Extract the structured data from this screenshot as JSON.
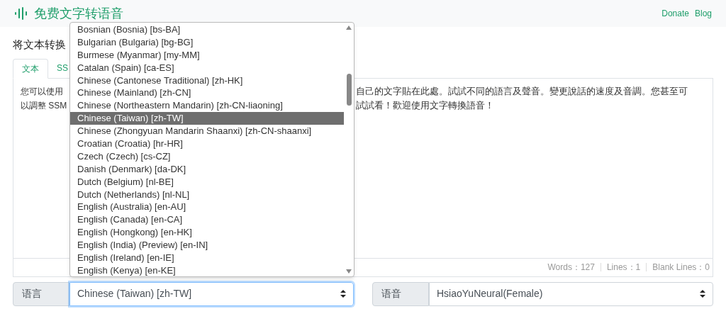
{
  "navbar": {
    "brand": "免费文字转语音",
    "links": [
      "Donate",
      "Blog"
    ]
  },
  "heading": "将文本转换",
  "tabs": [
    {
      "label": "文本",
      "selected": true
    },
    {
      "label": "SS",
      "selected": false
    }
  ],
  "editor": {
    "lines": [
      {
        "left": "您可以使用",
        "right": "自己的文字貼在此處。試試不同的語言及聲音。變更說話的速度及音調。您甚至可"
      },
      {
        "left": "以調整 SSM",
        "right": "試試看！歡迎使用文字轉換語音！"
      }
    ]
  },
  "stats": [
    "Words：127",
    "Lines：1",
    "Blank Lines：0"
  ],
  "language": {
    "label": "语言",
    "value": "Chinese (Taiwan) [zh-TW]",
    "focused": true
  },
  "voice": {
    "label": "语音",
    "value": "HsiaoYuNeural(Female)",
    "focused": false
  },
  "dropdown": {
    "options": [
      {
        "label": "Bosnian (Bosnia) [bs-BA]",
        "selected": false
      },
      {
        "label": "Bulgarian (Bulgaria) [bg-BG]",
        "selected": false
      },
      {
        "label": "Burmese (Myanmar) [my-MM]",
        "selected": false
      },
      {
        "label": "Catalan (Spain) [ca-ES]",
        "selected": false
      },
      {
        "label": "Chinese (Cantonese Traditional) [zh-HK]",
        "selected": false
      },
      {
        "label": "Chinese (Mainland) [zh-CN]",
        "selected": false
      },
      {
        "label": "Chinese (Northeastern Mandarin) [zh-CN-liaoning]",
        "selected": false
      },
      {
        "label": "Chinese (Taiwan) [zh-TW]",
        "selected": true
      },
      {
        "label": "Chinese (Zhongyuan Mandarin Shaanxi) [zh-CN-shaanxi]",
        "selected": false
      },
      {
        "label": "Croatian (Croatia) [hr-HR]",
        "selected": false
      },
      {
        "label": "Czech (Czech) [cs-CZ]",
        "selected": false
      },
      {
        "label": "Danish (Denmark) [da-DK]",
        "selected": false
      },
      {
        "label": "Dutch (Belgium) [nl-BE]",
        "selected": false
      },
      {
        "label": "Dutch (Netherlands) [nl-NL]",
        "selected": false
      },
      {
        "label": "English (Australia) [en-AU]",
        "selected": false
      },
      {
        "label": "English (Canada) [en-CA]",
        "selected": false
      },
      {
        "label": "English (Hongkong) [en-HK]",
        "selected": false
      },
      {
        "label": "English (India) (Preview) [en-IN]",
        "selected": false
      },
      {
        "label": "English (Ireland) [en-IE]",
        "selected": false
      },
      {
        "label": "English (Kenya) [en-KE]",
        "selected": false
      }
    ]
  }
}
